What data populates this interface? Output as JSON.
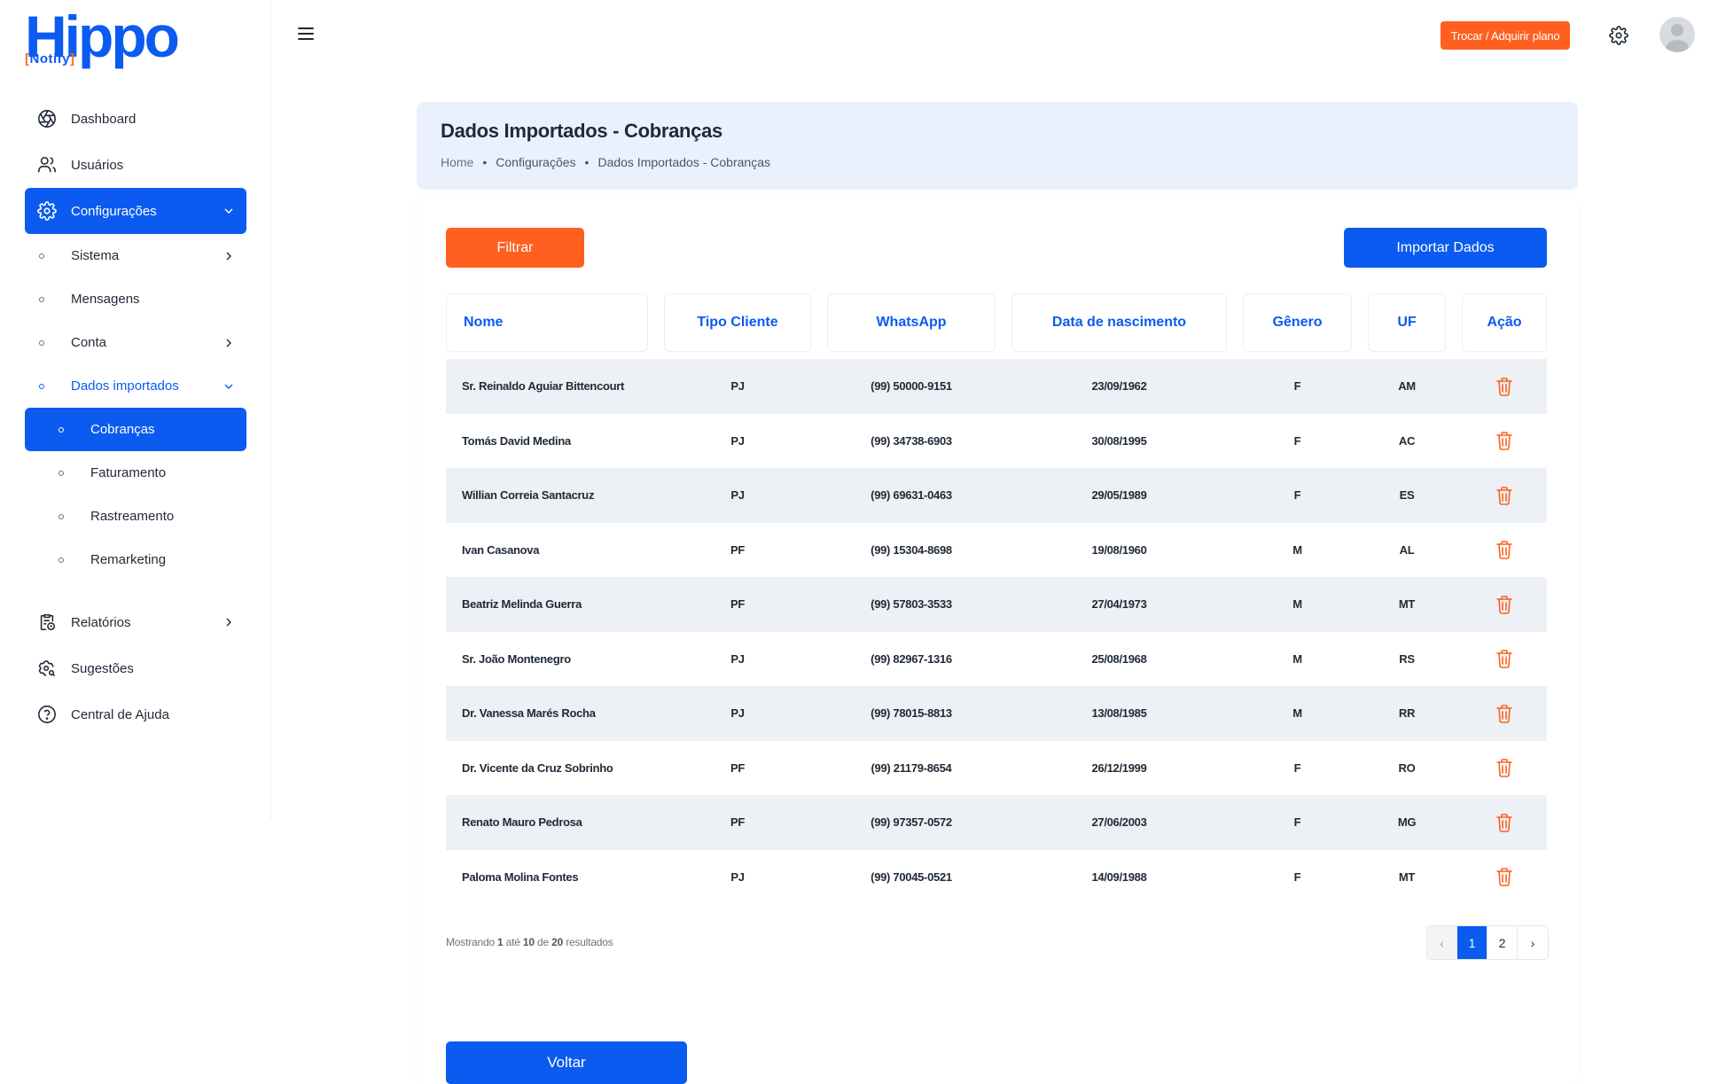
{
  "brand": {
    "name": "Hippo",
    "sub_open": "[",
    "sub_text": "Notify",
    "sub_close": "]",
    "primary": "#0b5bf0",
    "accent": "#ff5f1f"
  },
  "sidebar": {
    "items": [
      {
        "label": "Dashboard",
        "icon": "aperture-icon"
      },
      {
        "label": "Usuários",
        "icon": "users-icon"
      },
      {
        "label": "Configurações",
        "icon": "gear-icon"
      },
      {
        "label": "Relatórios",
        "icon": "report-icon"
      },
      {
        "label": "Sugestões",
        "icon": "settings-search-icon"
      },
      {
        "label": "Central de Ajuda",
        "icon": "help-icon"
      }
    ],
    "config_sub": [
      "Sistema",
      "Mensagens",
      "Conta",
      "Dados importados"
    ],
    "imported_sub": [
      "Cobranças",
      "Faturamento",
      "Rastreamento",
      "Remarketing"
    ]
  },
  "topbar": {
    "plan_button": "Trocar / Adquirir plano"
  },
  "header": {
    "title": "Dados Importados - Cobranças",
    "breadcrumbs": [
      "Home",
      "Configurações",
      "Dados Importados - Cobranças"
    ]
  },
  "toolbar": {
    "filter": "Filtrar",
    "import": "Importar Dados"
  },
  "table": {
    "columns": [
      "Nome",
      "Tipo Cliente",
      "WhatsApp",
      "Data de nascimento",
      "Gênero",
      "UF",
      "Ação"
    ],
    "rows": [
      [
        "Sr. Reinaldo Aguiar Bittencourt",
        "PJ",
        "(99) 50000-9151",
        "23/09/1962",
        "F",
        "AM"
      ],
      [
        "Tomás David Medina",
        "PJ",
        "(99) 34738-6903",
        "30/08/1995",
        "F",
        "AC"
      ],
      [
        "Willian Correia Santacruz",
        "PJ",
        "(99) 69631-0463",
        "29/05/1989",
        "F",
        "ES"
      ],
      [
        "Ivan Casanova",
        "PF",
        "(99) 15304-8698",
        "19/08/1960",
        "M",
        "AL"
      ],
      [
        "Beatriz Melinda Guerra",
        "PF",
        "(99) 57803-3533",
        "27/04/1973",
        "M",
        "MT"
      ],
      [
        "Sr. João Montenegro",
        "PJ",
        "(99) 82967-1316",
        "25/08/1968",
        "M",
        "RS"
      ],
      [
        "Dr. Vanessa Marés Rocha",
        "PJ",
        "(99) 78015-8813",
        "13/08/1985",
        "M",
        "RR"
      ],
      [
        "Dr. Vicente da Cruz Sobrinho",
        "PF",
        "(99) 21179-8654",
        "26/12/1999",
        "F",
        "RO"
      ],
      [
        "Renato Mauro Pedrosa",
        "PF",
        "(99) 97357-0572",
        "27/06/2003",
        "F",
        "MG"
      ],
      [
        "Paloma Molina Fontes",
        "PJ",
        "(99) 70045-0521",
        "14/09/1988",
        "F",
        "MT"
      ]
    ]
  },
  "footer": {
    "showing_prefix": "Mostrando",
    "from": "1",
    "to_word": "até",
    "to": "10",
    "of_word": "de",
    "total": "20",
    "suffix": "resultados",
    "pages": [
      "‹",
      "1",
      "2",
      "›"
    ],
    "current_page": "1"
  },
  "back_button": "Voltar"
}
